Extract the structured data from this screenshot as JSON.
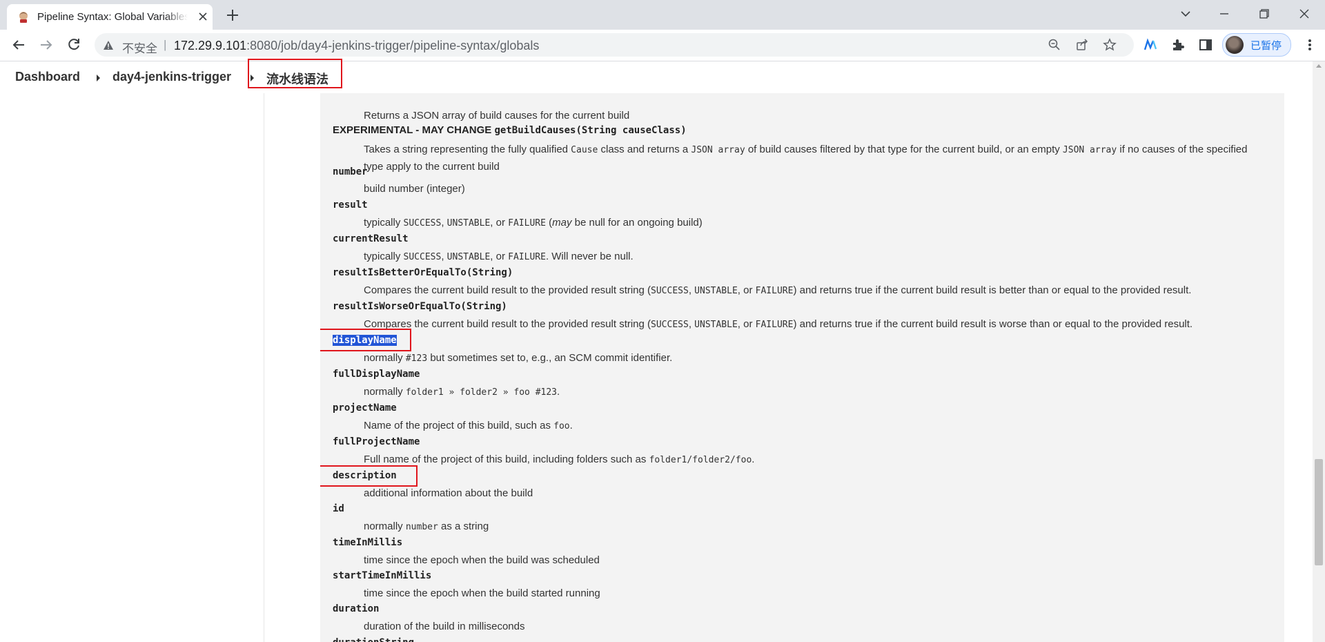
{
  "browser": {
    "tab_title": "Pipeline Syntax: Global Variables Reference",
    "security_label": "不安全",
    "url_host": "172.29.9.101",
    "url_rest": ":8080/job/day4-jenkins-trigger/pipeline-syntax/globals",
    "profile_label": "已暂停"
  },
  "breadcrumb": {
    "items": [
      "Dashboard",
      "day4-jenkins-trigger",
      "流水线语法"
    ]
  },
  "doc": {
    "causes_def": "Returns a JSON array of build causes for the current build",
    "experimental_prefix": "EXPERIMENTAL - MAY CHANGE ",
    "experimental_sig": "getBuildCauses(String causeClass)",
    "experimental_def": {
      "a": "Takes a string representing the fully qualified ",
      "code1": "Cause",
      "b": " class and returns a ",
      "code2": "JSON array",
      "c": " of build causes filtered by that type for the current build, or an empty ",
      "code3": "JSON array",
      "d": " if no causes of the specified type apply to the current build"
    },
    "number": {
      "term": "number",
      "def": "build number (integer)"
    },
    "result": {
      "term": "result",
      "a": "typically ",
      "c1": "SUCCESS",
      "b": ", ",
      "c2": "UNSTABLE",
      "c": ", or ",
      "c3": "FAILURE",
      "d": " (",
      "em": "may",
      "e": " be null for an ongoing build)"
    },
    "currentResult": {
      "term": "currentResult",
      "a": "typically ",
      "c1": "SUCCESS",
      "b": ", ",
      "c2": "UNSTABLE",
      "c": ", or ",
      "c3": "FAILURE",
      "d": ". Will never be null."
    },
    "better": {
      "term": "resultIsBetterOrEqualTo(String)",
      "a": "Compares the current build result to the provided result string (",
      "c1": "SUCCESS",
      "b": ", ",
      "c2": "UNSTABLE",
      "c": ", or ",
      "c3": "FAILURE",
      "d": ") and returns true if the current build result is better than or equal to the provided result."
    },
    "worse": {
      "term": "resultIsWorseOrEqualTo(String)",
      "a": "Compares the current build result to the provided result string (",
      "c1": "SUCCESS",
      "b": ", ",
      "c2": "UNSTABLE",
      "c": ", or ",
      "c3": "FAILURE",
      "d": ") and returns true if the current build result is worse than or equal to the provided result."
    },
    "displayName": {
      "term": "displayName",
      "a": "normally ",
      "code": "#123",
      "b": " but sometimes set to, e.g., an SCM commit identifier."
    },
    "fullDisplayName": {
      "term": "fullDisplayName",
      "a": "normally ",
      "code": "folder1 » folder2 » foo #123",
      "b": "."
    },
    "projectName": {
      "term": "projectName",
      "a": "Name of the project of this build, such as ",
      "code": "foo",
      "b": "."
    },
    "fullProjectName": {
      "term": "fullProjectName",
      "a": "Full name of the project of this build, including folders such as ",
      "code": "folder1/folder2/foo",
      "b": "."
    },
    "description": {
      "term": "description",
      "def": "additional information about the build"
    },
    "id": {
      "term": "id",
      "a": "normally ",
      "code": "number",
      "b": " as a string"
    },
    "timeInMillis": {
      "term": "timeInMillis",
      "def": "time since the epoch when the build was scheduled"
    },
    "startTimeInMillis": {
      "term": "startTimeInMillis",
      "def": "time since the epoch when the build started running"
    },
    "duration": {
      "term": "duration",
      "def": "duration of the build in milliseconds"
    },
    "durationString": {
      "term": "durationString"
    }
  },
  "colors": {
    "highlight_box": "#e0151c",
    "selection": "#2255d6",
    "panel_bg": "#f3f3f3"
  }
}
